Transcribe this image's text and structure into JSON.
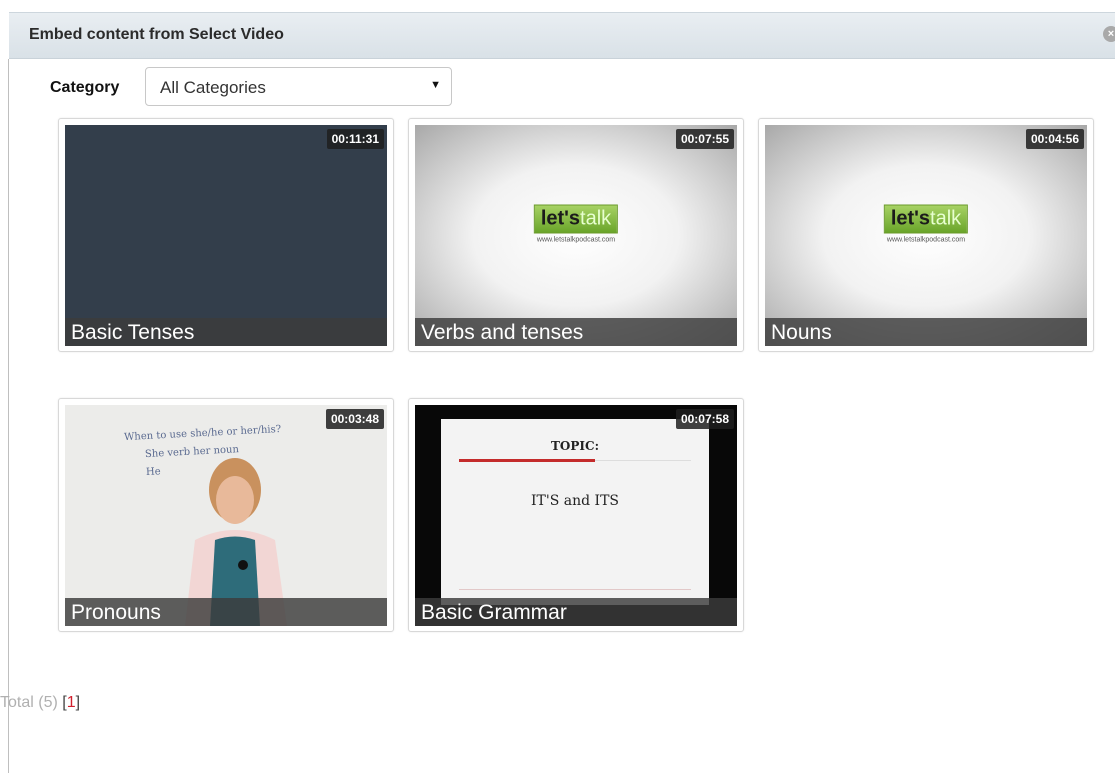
{
  "dialog": {
    "title": "Embed content from Select Video",
    "close_icon": "close-icon"
  },
  "filter": {
    "label": "Category",
    "selected": "All Categories",
    "arrow": "▼"
  },
  "videos": [
    {
      "title": "Basic Tenses",
      "duration": "00:11:31",
      "thumb": "dark-slate"
    },
    {
      "title": "Verbs and tenses",
      "duration": "00:07:55",
      "thumb": "lets-talk-logo"
    },
    {
      "title": "Nouns",
      "duration": "00:04:56",
      "thumb": "lets-talk-logo"
    },
    {
      "title": "Pronouns",
      "duration": "00:03:48",
      "thumb": "teacher-whiteboard"
    },
    {
      "title": "Basic Grammar",
      "duration": "00:07:58",
      "thumb": "topic-slide"
    }
  ],
  "logo": {
    "lets": "let's",
    "talk": "talk",
    "url": "www.letstalkpodcast.com"
  },
  "slide": {
    "heading": "TOPIC:",
    "text": "IT'S and ITS"
  },
  "whiteboard": {
    "line1": "When to use she/he or her/his?",
    "line2": "She     verb     her   noun",
    "line3": "He"
  },
  "pagination": {
    "total_label": "Total (5)",
    "open": "[",
    "page": "1",
    "close": "]"
  },
  "colors": {
    "accent_red": "#d0202e",
    "header_bg": "#dfe6eb"
  }
}
